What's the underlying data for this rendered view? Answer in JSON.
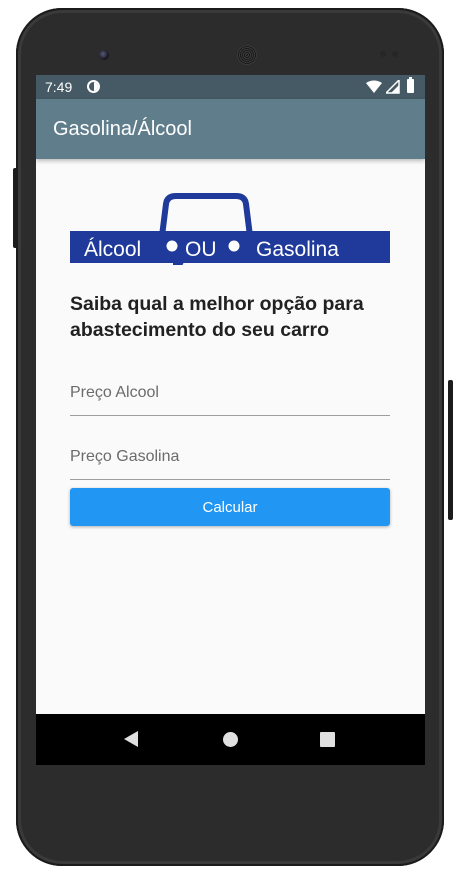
{
  "status_bar": {
    "time": "7:49",
    "icons": [
      "app-notification-icon",
      "wifi-icon",
      "signal-icon",
      "battery-icon"
    ]
  },
  "app_bar": {
    "title": "Gasolina/Álcool"
  },
  "logo": {
    "left_text": "Álcool",
    "middle_text": "OU",
    "right_text": "Gasolina",
    "color": "#1f3a9a"
  },
  "headline": "Saiba qual a melhor opção para abastecimento do seu carro",
  "fields": {
    "alcool": {
      "placeholder": "Preço Alcool",
      "value": ""
    },
    "gasolina": {
      "placeholder": "Preço Gasolina",
      "value": ""
    }
  },
  "calculate_button": {
    "label": "Calcular",
    "color": "#2196f3"
  },
  "nav_bar": {
    "icons": [
      "back-icon",
      "home-icon",
      "recents-icon"
    ]
  },
  "colors": {
    "status_bar": "#455a64",
    "app_bar": "#607d8b",
    "background": "#fafafa"
  }
}
